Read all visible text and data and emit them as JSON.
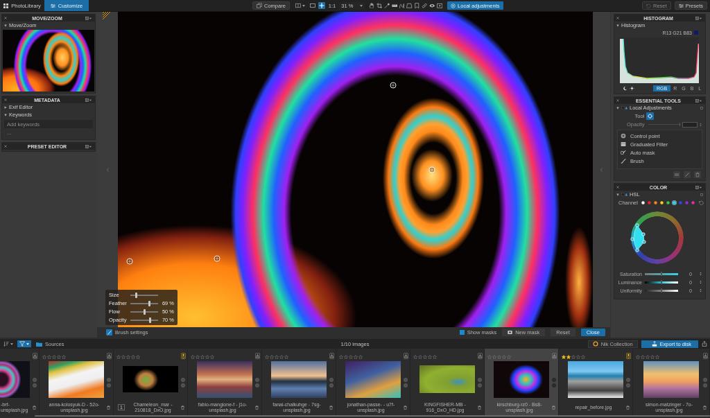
{
  "top_bar": {
    "tabs": [
      {
        "label": "PhotoLibrary",
        "selected": false
      },
      {
        "label": "Customize",
        "selected": true
      }
    ],
    "compare": "Compare",
    "view_tools": [
      {
        "kind": "single-view",
        "selected": false
      },
      {
        "kind": "move",
        "selected": true
      }
    ],
    "zoom_fit": "1:1",
    "zoom_level": "31 %",
    "local_adjustments": {
      "label": "Local adjustments",
      "active": true
    },
    "reset": {
      "label": "Reset",
      "disabled": true
    },
    "presets": "Presets"
  },
  "left_panel": {
    "move_zoom": {
      "title": "MOVE/ZOOM",
      "section": {
        "label": "Move/Zoom",
        "expanded": true
      }
    },
    "metadata": {
      "title": "METADATA",
      "sections": [
        {
          "label": "Exif Editor",
          "expanded": false
        },
        {
          "label": "Keywords",
          "expanded": true
        }
      ],
      "keywords_placeholder": "Add keywords",
      "keywords_more": "..."
    },
    "preset_editor": {
      "title": "PRESET EDITOR"
    }
  },
  "viewer": {
    "brush_settings": [
      {
        "label": "Size",
        "level": 0.22
      },
      {
        "label": "Feather",
        "level": 0.69,
        "reading": "69 %"
      },
      {
        "label": "Flow",
        "level": 0.5,
        "reading": "50 %"
      },
      {
        "label": "Opacity",
        "level": 0.7,
        "reading": "70 %"
      }
    ],
    "bar": {
      "brush_settings": {
        "label": "Brush settings",
        "checked": true
      },
      "show_masks": {
        "label": "Show masks",
        "checked": true
      },
      "new_mask": "New mask",
      "reset": "Reset",
      "close": "Close"
    }
  },
  "right_panel": {
    "histogram": {
      "title": "HISTOGRAM",
      "section": {
        "label": "Histogram",
        "expanded": true
      },
      "readout": "R13 G21 B83",
      "channels": [
        {
          "label": "RGB",
          "selected": true
        },
        {
          "label": "R",
          "selected": false
        },
        {
          "label": "G",
          "selected": false
        },
        {
          "label": "B",
          "selected": false
        },
        {
          "label": "L",
          "selected": false
        }
      ]
    },
    "essential_tools": {
      "title": "ESSENTIAL TOOLS",
      "section": {
        "label": "Local Adjustments",
        "expanded": true,
        "enabled": true
      },
      "tool_label": "Tool",
      "opacity": {
        "label": "Opacity",
        "disabled": true
      },
      "mask_tools": [
        {
          "kind": "control-point",
          "label": "Control point"
        },
        {
          "kind": "graduated-filter",
          "label": "Graduated Filter"
        },
        {
          "kind": "auto-mask",
          "label": "Auto mask"
        },
        {
          "kind": "brush",
          "label": "Brush"
        }
      ]
    },
    "color": {
      "title": "COLOR",
      "section": {
        "label": "HSL",
        "expanded": true,
        "enabled": true
      },
      "channel_label": "Channel",
      "channels": [
        {
          "color": "#ffffff",
          "selected": false
        },
        {
          "color": "#e8242c",
          "selected": false
        },
        {
          "color": "#f08a1c",
          "selected": false
        },
        {
          "color": "#f4d21c",
          "selected": false
        },
        {
          "color": "#3cc83c",
          "selected": false
        },
        {
          "color": "#2ad4f0",
          "selected": true
        },
        {
          "color": "#2848e8",
          "selected": false
        },
        {
          "color": "#8a2ce0",
          "selected": false
        },
        {
          "color": "#e02cb4",
          "selected": false
        }
      ],
      "sliders": [
        {
          "kind": "saturation",
          "label": "Saturation",
          "level": 0.5,
          "reading": "0"
        },
        {
          "kind": "luminance",
          "label": "Luminance",
          "level": 0.5,
          "reading": "0"
        },
        {
          "kind": "uniformity",
          "label": "Uniformity",
          "level": 0.5,
          "reading": "0"
        }
      ]
    }
  },
  "filmstrip": {
    "toolbar": {
      "source": "Sources",
      "count": "1/10 images",
      "nik_collection": "Nik Collection",
      "export": "Export to disk"
    },
    "thumbnails": [
      {
        "name": "-brf-unsplash.jpg",
        "selected": false,
        "processed": false
      },
      {
        "name": "anna-kolosyuk-D - 52o-unsplash.jpg",
        "selected": false,
        "processed": false,
        "stars": 0
      },
      {
        "name": "Chameleon_mar - 210818_DxO.jpg",
        "copy": "1",
        "selected": false,
        "processed": true,
        "stars": 0
      },
      {
        "name": "fabio-mangione-f - j1o-unsplash.jpg",
        "selected": false,
        "processed": false,
        "stars": 0
      },
      {
        "name": "fanai-chalkuhge - 7sg-unsplash.jpg",
        "selected": false,
        "processed": false,
        "stars": 0
      },
      {
        "name": "jonathan-passe- - u7f-unsplash.jpg",
        "selected": false,
        "processed": false,
        "stars": 0
      },
      {
        "name": "KINGFISHER-MB - 916_DxO_HD.jpg",
        "selected": false,
        "processed": false,
        "stars": 0
      },
      {
        "name": "kirschburg-rz0 - Bs8-unsplash.jpg",
        "selected": true,
        "processed": false,
        "stars": 0
      },
      {
        "name": "repair_before.jpg",
        "selected": false,
        "processed": true,
        "stars": 2
      },
      {
        "name": "simon-matzinger - 7o-unsplash.jpg",
        "selected": false,
        "processed": false,
        "stars": 0
      }
    ]
  }
}
